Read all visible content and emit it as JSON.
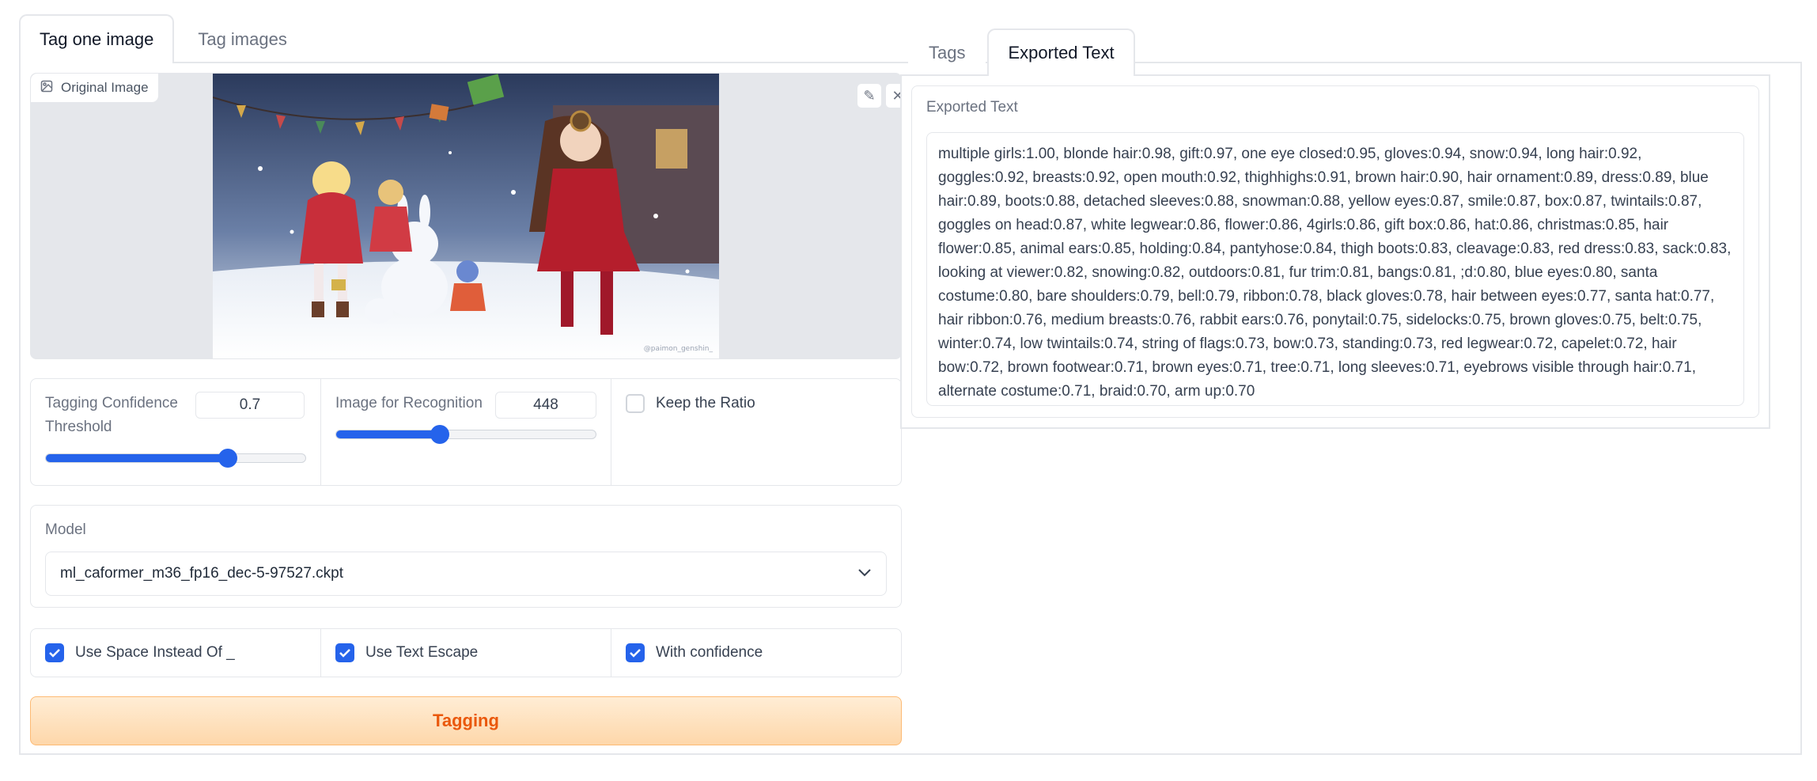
{
  "top_tabs": [
    {
      "label": "Tag one image",
      "active": true
    },
    {
      "label": "Tag images",
      "active": false
    }
  ],
  "image_panel": {
    "label": "Original Image",
    "watermark": "@paimon_genshin_"
  },
  "threshold": {
    "label": "Tagging Confidence Threshold",
    "value": "0.7",
    "fraction": 0.7
  },
  "recognition": {
    "label": "Image for Recognition",
    "value": "448",
    "fraction": 0.4
  },
  "keep_ratio": {
    "label": "Keep the Ratio",
    "checked": false
  },
  "model": {
    "label": "Model",
    "selected": "ml_caformer_m36_fp16_dec-5-97527.ckpt"
  },
  "options": [
    {
      "label": "Use Space Instead Of _",
      "checked": true
    },
    {
      "label": "Use Text Escape",
      "checked": true
    },
    {
      "label": "With confidence",
      "checked": true
    }
  ],
  "tag_button": {
    "label": "Tagging"
  },
  "right_tabs": [
    {
      "label": "Tags",
      "active": false
    },
    {
      "label": "Exported Text",
      "active": true
    }
  ],
  "export": {
    "label": "Exported Text",
    "text": "multiple girls:1.00, blonde hair:0.98, gift:0.97, one eye closed:0.95, gloves:0.94, snow:0.94, long hair:0.92, goggles:0.92, breasts:0.92, open mouth:0.92, thighhighs:0.91, brown hair:0.90, hair ornament:0.89, dress:0.89, blue hair:0.89, boots:0.88, detached sleeves:0.88, snowman:0.88, yellow eyes:0.87, smile:0.87, box:0.87, twintails:0.87, goggles on head:0.87, white legwear:0.86, flower:0.86, 4girls:0.86, gift box:0.86, hat:0.86, christmas:0.85, hair flower:0.85, animal ears:0.85, holding:0.84, pantyhose:0.84, thigh boots:0.83, cleavage:0.83, red dress:0.83, sack:0.83, looking at viewer:0.82, snowing:0.82, outdoors:0.81, fur trim:0.81, bangs:0.81, ;d:0.80, blue eyes:0.80, santa costume:0.80, bare shoulders:0.79, bell:0.79, ribbon:0.78, black gloves:0.78, hair between eyes:0.77, santa hat:0.77, hair ribbon:0.76, medium breasts:0.76, rabbit ears:0.76, ponytail:0.75, sidelocks:0.75, brown gloves:0.75, belt:0.75, winter:0.74, low twintails:0.74, string of flags:0.73, bow:0.73, standing:0.73, red legwear:0.72, capelet:0.72, hair bow:0.72, brown footwear:0.71, brown eyes:0.71, tree:0.71, long sleeves:0.71, eyebrows visible through hair:0.71, alternate costume:0.71, braid:0.70, arm up:0.70"
  },
  "colors": {
    "accent": "#2563eb",
    "button_text": "#ea580c",
    "button_bg": "#fed7aa",
    "border": "#e5e7eb"
  }
}
